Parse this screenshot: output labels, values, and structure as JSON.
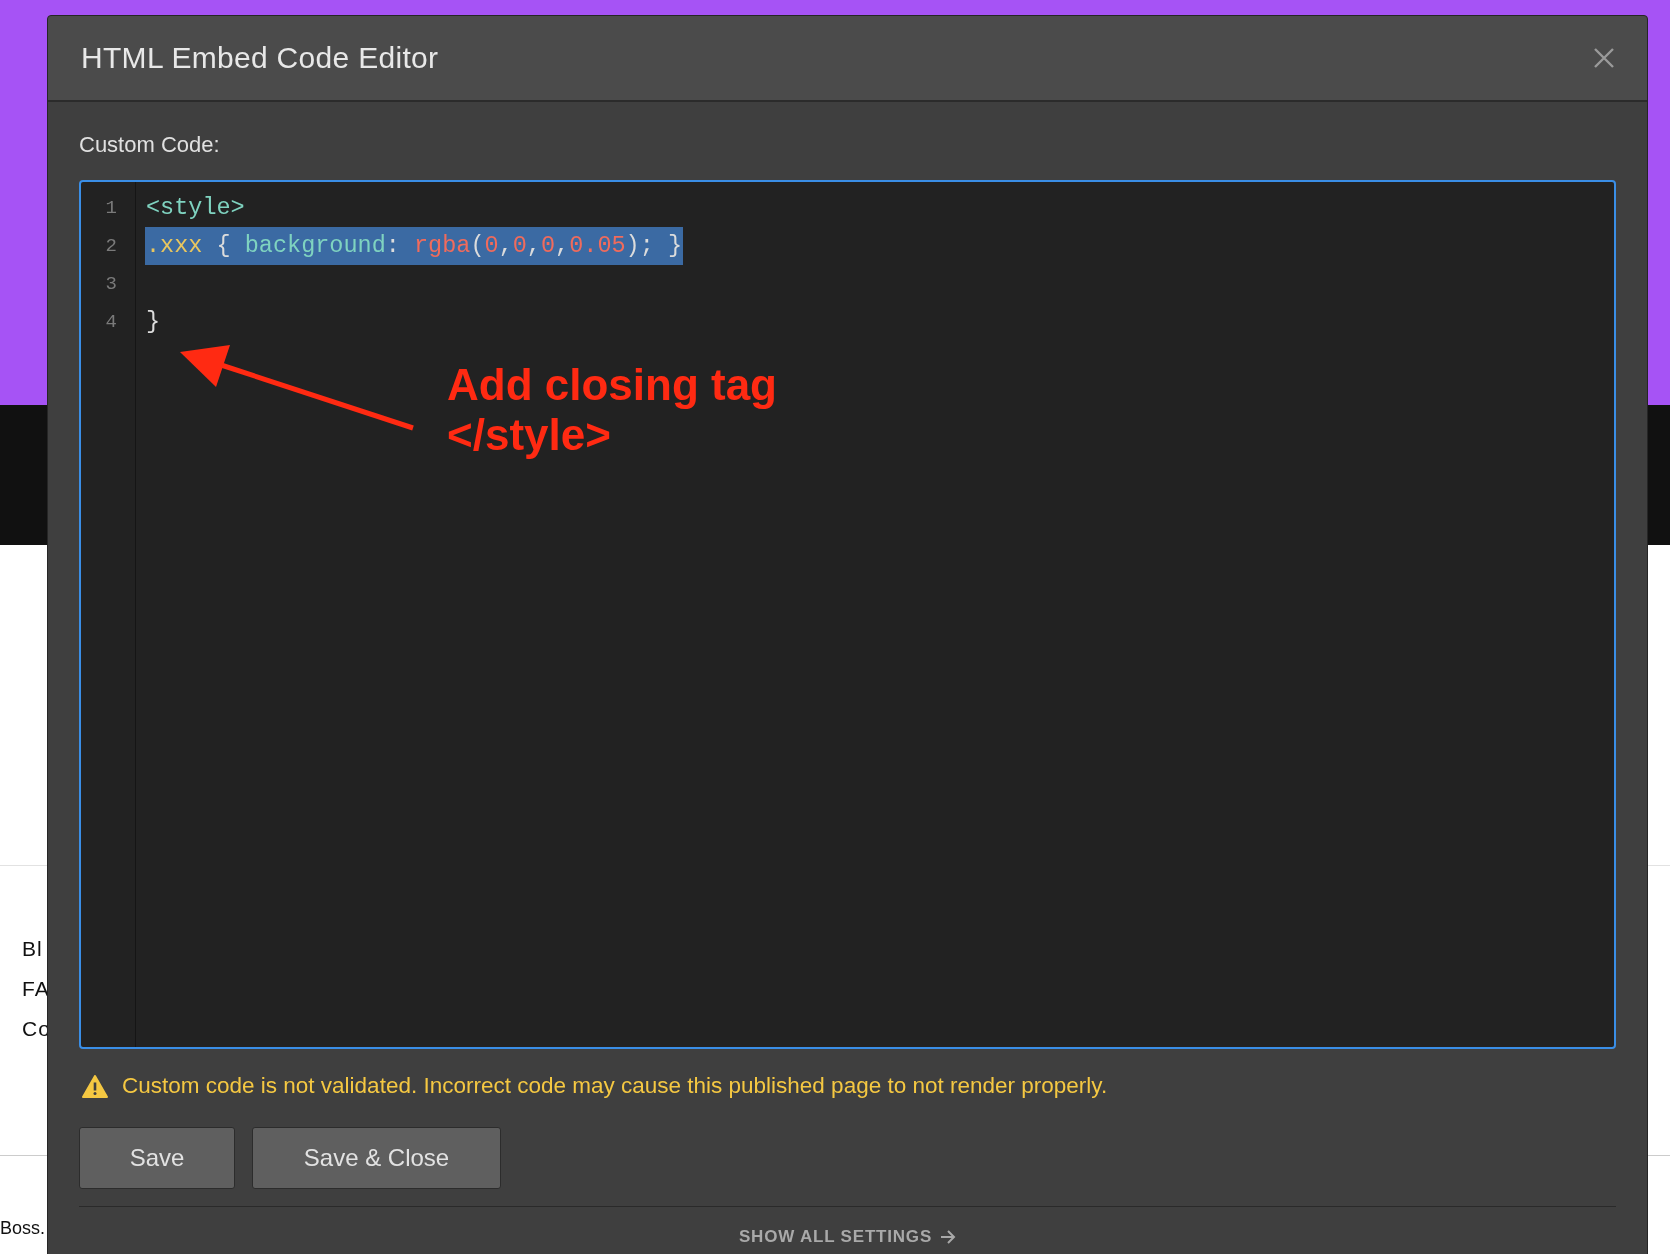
{
  "background_page": {
    "links": [
      "Bl",
      "FA",
      "Co"
    ],
    "footer_text": "Boss."
  },
  "dialog": {
    "title": "HTML Embed Code Editor",
    "field_label": "Custom Code:",
    "code_lines": [
      {
        "number": "1",
        "selected": false,
        "tokens": [
          {
            "kind": "tag",
            "text": "<style>"
          }
        ]
      },
      {
        "number": "2",
        "selected": true,
        "tokens": [
          {
            "kind": "selector",
            "text": ".xxx"
          },
          {
            "kind": "punct",
            "text": " { "
          },
          {
            "kind": "property",
            "text": "background"
          },
          {
            "kind": "punct",
            "text": ": "
          },
          {
            "kind": "func",
            "text": "rgba"
          },
          {
            "kind": "punct",
            "text": "("
          },
          {
            "kind": "number",
            "text": "0"
          },
          {
            "kind": "punct",
            "text": ","
          },
          {
            "kind": "number",
            "text": "0"
          },
          {
            "kind": "punct",
            "text": ","
          },
          {
            "kind": "number",
            "text": "0"
          },
          {
            "kind": "punct",
            "text": ","
          },
          {
            "kind": "number",
            "text": "0.05"
          },
          {
            "kind": "punct",
            "text": "); }"
          }
        ]
      },
      {
        "number": "3",
        "selected": false
      },
      {
        "number": "4",
        "selected": false,
        "tokens": [
          {
            "kind": "punct",
            "text": "}"
          }
        ]
      }
    ],
    "warning": "Custom code is not validated. Incorrect code may cause this published page to not render properly.",
    "buttons": [
      "Save",
      "Save & Close"
    ],
    "footer_link": "SHOW ALL SETTINGS"
  },
  "annotation": {
    "lines": [
      "Add closing tag",
      "</style>"
    ]
  }
}
